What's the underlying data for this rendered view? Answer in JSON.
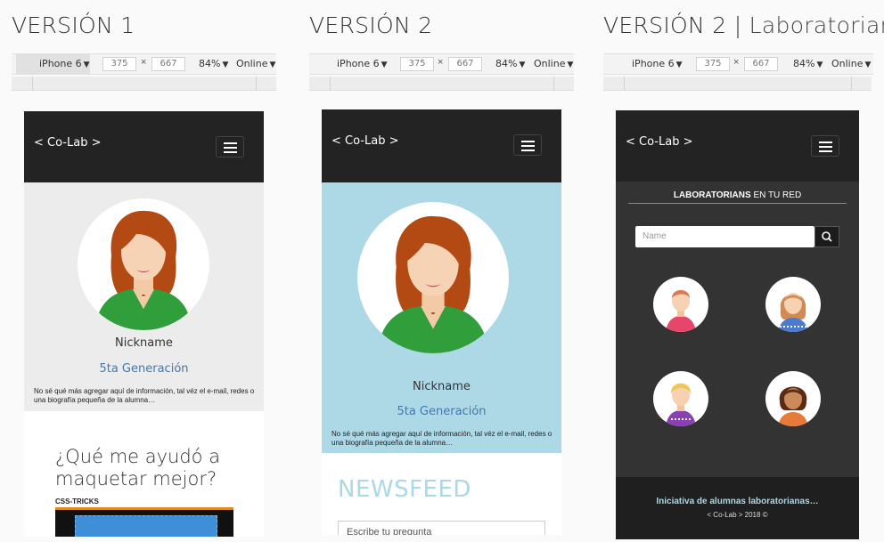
{
  "v1": {
    "title": "VERSIÓN 1",
    "device": "iPhone 6",
    "width": "375",
    "height": "667",
    "zoom": "84%",
    "network": "Online",
    "brand": "< Co-Lab >",
    "nickname": "Nickname",
    "generation": "5ta Generación",
    "bio": "No sé qué más agregar aquí de información, tal véz el e-mail, redes o una biografía pequeña de la alumna…",
    "question": "¿Qué me ayudó a maquetar mejor?",
    "resource": "CSS-TRICKS"
  },
  "v2": {
    "title": "VERSIÓN 2",
    "device": "iPhone 6",
    "width": "375",
    "height": "667",
    "zoom": "84%",
    "network": "Online",
    "brand": "< Co-Lab >",
    "nickname": "Nickname",
    "generation": "5ta Generación",
    "bio": "No sé qué más agregar aquí de información, tal véz el e-mail, redes o una biografía pequeña de la alumna…",
    "newsfeed": "NEWSFEED",
    "ask_placeholder": "Escribe tu pregunta"
  },
  "v3": {
    "title": "VERSIÓN 2",
    "title_sep": " | ",
    "title_suffix": "Laboratorians",
    "device": "iPhone 6",
    "width": "375",
    "height": "667",
    "zoom": "84%",
    "network": "Online",
    "brand": "< Co-Lab >",
    "heading_bold": "LABORATORIANS",
    "heading_rest": " EN TU RED",
    "search_placeholder": "Name",
    "footer_line1": "Iniciativa de alumnas laboratorianas…",
    "footer_line2": "< Co-Lab > 2018 ©"
  },
  "icons": {
    "dropdown": "caret-down-icon",
    "menu": "hamburger-icon",
    "search": "search-icon"
  },
  "colors": {
    "navbar": "#232323",
    "profile_bg_v1": "#ececec",
    "profile_bg_v2": "#add8e6",
    "lab_bg": "#333333",
    "link": "#3a7bb5",
    "newsfeed": "#a9d8e8",
    "footer_text": "#a9d8e8"
  }
}
